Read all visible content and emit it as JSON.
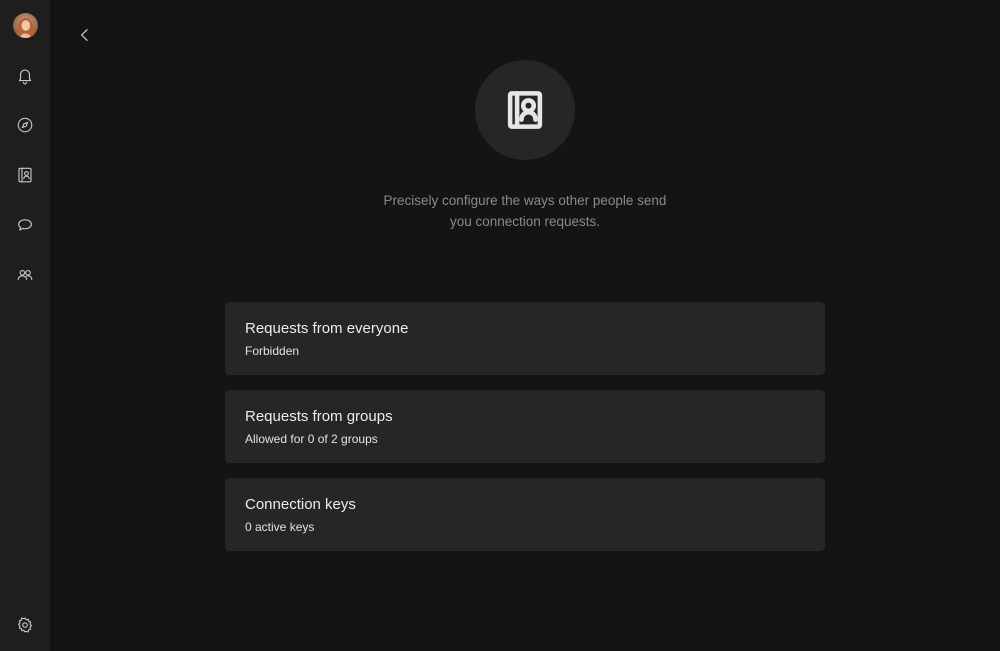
{
  "sidebar": {
    "items": [
      {
        "name": "notifications",
        "icon": "bell-icon"
      },
      {
        "name": "explore",
        "icon": "compass-icon"
      },
      {
        "name": "contacts",
        "icon": "contact-book-icon"
      },
      {
        "name": "chats",
        "icon": "chat-bubble-icon"
      },
      {
        "name": "groups",
        "icon": "people-icon"
      }
    ],
    "settings_icon": "gear-icon"
  },
  "main": {
    "back_icon": "chevron-left-icon",
    "hero_icon": "contact-book-icon",
    "description": "Precisely configure the ways other people send you connection requests.",
    "cards": [
      {
        "title": "Requests from everyone",
        "subtitle": "Forbidden"
      },
      {
        "title": "Requests from groups",
        "subtitle": "Allowed for 0 of 2 groups"
      },
      {
        "title": "Connection keys",
        "subtitle": "0 active keys"
      }
    ]
  },
  "colors": {
    "background": "#141414",
    "sidebar": "#1e1e1e",
    "card": "#262626",
    "text_primary": "#ececec",
    "text_muted": "#8a8a8a"
  }
}
